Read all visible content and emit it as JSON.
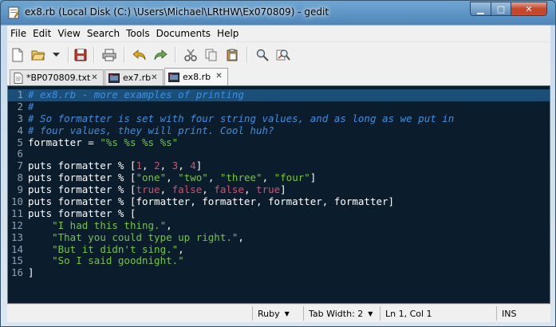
{
  "window": {
    "title": "ex8.rb (Local Disk (C:) \\Users\\Michael\\LRtHW\\Ex070809) - gedit"
  },
  "menu": [
    "File",
    "Edit",
    "View",
    "Search",
    "Tools",
    "Documents",
    "Help"
  ],
  "toolbar": {
    "buttons": [
      "new-document-icon",
      "open-folder-icon",
      "open-dropdown-icon",
      "save-icon",
      "print-icon",
      "undo-icon",
      "redo-icon",
      "cut-icon",
      "copy-icon",
      "paste-icon",
      "find-icon",
      "find-replace-icon"
    ]
  },
  "tabs": [
    {
      "label": "*BP070809.txt",
      "active": false
    },
    {
      "label": "ex7.rb",
      "active": false
    },
    {
      "label": "ex8.rb",
      "active": true
    }
  ],
  "editor": {
    "line_numbers": [
      "1",
      "2",
      "3",
      "4",
      "5",
      "6",
      "7",
      "8",
      "9",
      "10",
      "11",
      "12",
      "13",
      "14",
      "15",
      "16"
    ],
    "current_line": 1
  },
  "status": {
    "language": "Ruby",
    "tab_width": "Tab Width: 2",
    "position": "Ln 1, Col 1",
    "mode": "INS"
  },
  "colors": {
    "editor_bg": "#0b1c2c",
    "comment": "#3f8fe0",
    "string": "#76c44a",
    "number": "#e04a6a",
    "plain": "#ffffff"
  }
}
